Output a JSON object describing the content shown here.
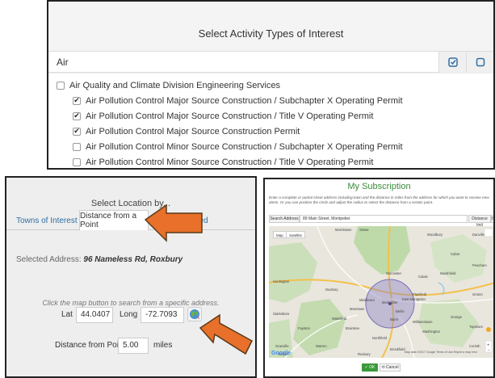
{
  "activity_panel": {
    "title": "Select Activity Types of Interest",
    "search_value": "Air",
    "items": [
      {
        "label": "Air Quality and Climate Division Engineering Services",
        "checked": false,
        "indent": 0
      },
      {
        "label": "Air Pollution Control Major Source Construction / Subchapter X Operating Permit",
        "checked": true,
        "indent": 1
      },
      {
        "label": "Air Pollution Control Major Source Construction / Title V Operating Permit",
        "checked": true,
        "indent": 1
      },
      {
        "label": "Air Pollution Control Major Source Construction Permit",
        "checked": true,
        "indent": 1
      },
      {
        "label": "Air Pollution Control Minor Source Construction / Subchapter X Operating Permit",
        "checked": false,
        "indent": 1
      },
      {
        "label": "Air Pollution Control Minor Source Construction / Title V Operating Permit",
        "checked": false,
        "indent": 1
      }
    ]
  },
  "location_panel": {
    "title": "Select Location by...",
    "tabs": [
      "Towns of Interest",
      "Distance from a Point",
      "ched"
    ],
    "selected_address_label": "Selected Address:",
    "selected_address_value": "96 Nameless Rd, Roxbury",
    "instruction": "Click the map button to search from a specific address.",
    "lat_label": "Lat",
    "lat_value": "44.0407",
    "long_label": "Long",
    "long_value": "-72.7093",
    "distance_label": "Distance from Point",
    "distance_value": "5.00",
    "distance_unit": "miles"
  },
  "subscription_panel": {
    "title": "My Subscription",
    "instruction": "Enter a complete or partial street address including town and the distance in miles from the address for which you want to receive new alerts. Or you can position the circle and adjust the radius to select the distance from a certain point.",
    "address_label": "Search Address",
    "address_value": "89 Main Street, Montpelier",
    "distance_label": "Distance (mi)",
    "distance_value": "8",
    "map_tabs": [
      "Map",
      "Satellite"
    ],
    "map_places": [
      "Montpelier",
      "Middlesex",
      "Worcester",
      "Barre",
      "Waitsfield",
      "Northfield",
      "Warren",
      "Washington",
      "Morristown",
      "Stowe",
      "Woodbury",
      "Cabot",
      "Marshfield",
      "Plainfield",
      "Duxbury",
      "Moretown",
      "Berlin",
      "Fayston",
      "Roxbury",
      "Brookfield",
      "Granville",
      "Braintree",
      "Bethel",
      "Huntington",
      "Starksboro",
      "East Montpelier",
      "Calais",
      "Orange",
      "Topsham",
      "Corinth",
      "Peacham",
      "Danville",
      "Groton",
      "Williamstown"
    ],
    "map_attribution": "Map data ©2017 Google  Terms of Use  Report a map error",
    "ok_label": "OK",
    "cancel_label": "Cancel",
    "google_logo": "Google"
  },
  "colors": {
    "accent_orange": "#e8702a",
    "link_blue": "#2f6ea3",
    "title_green": "#3a8b3a",
    "circle_fill": "#8e84c4"
  }
}
